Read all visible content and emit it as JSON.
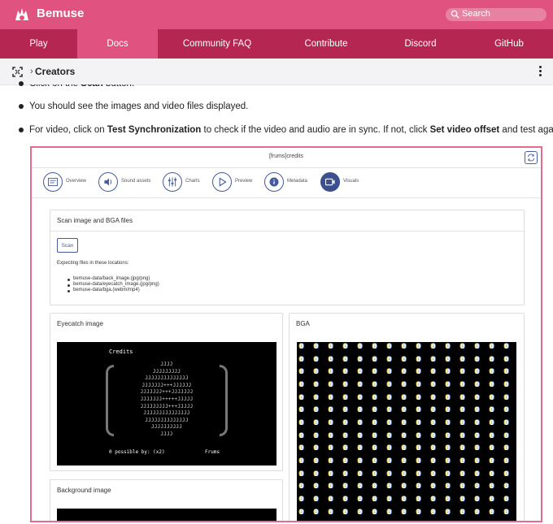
{
  "header": {
    "brand": "Bemuse",
    "search_placeholder": "Search",
    "brand_color": "#e0527f",
    "nav_color": "#b52653"
  },
  "nav": [
    {
      "label": "Play",
      "active": false
    },
    {
      "label": "Docs",
      "active": true
    },
    {
      "label": "Community FAQ",
      "active": false
    },
    {
      "label": "Contribute",
      "active": false
    },
    {
      "label": "Discord",
      "active": false
    },
    {
      "label": "GitHub",
      "active": false
    }
  ],
  "breadcrumb": {
    "current": "Creators"
  },
  "content": {
    "cut_line": {
      "pre": "Click on the ",
      "bold": "Scan",
      "post": " button."
    },
    "line2": "You should see the images and video files displayed.",
    "line3": {
      "pre": "For video, click on ",
      "bold1": "Test Synchronization",
      "mid": " to check if the video and audio are in sync. If not, click ",
      "bold2": "Set video offset",
      "post": " and test again."
    }
  },
  "screenshot": {
    "title": "[frums]credits",
    "tabs": [
      {
        "label": "Overview",
        "icon": "overview-icon",
        "active": false
      },
      {
        "label": "Sound assets",
        "icon": "speaker-icon",
        "active": false
      },
      {
        "label": "Charts",
        "icon": "sliders-icon",
        "active": false
      },
      {
        "label": "Preview",
        "icon": "play-icon",
        "active": false
      },
      {
        "label": "Metadata",
        "icon": "info-icon",
        "active": false
      },
      {
        "label": "Visuals",
        "icon": "video-icon",
        "active": true
      }
    ],
    "scan_panel": {
      "title": "Scan image and BGA files",
      "button": "Scan",
      "expect_label": "Expecting files in these locations:",
      "locations": [
        "bemuse-data/back_image.(jpg/png)",
        "bemuse-data/eyecatch_image.(jpg/png)",
        "bemuse-data/bga.(webm/mp4)"
      ]
    },
    "eyecatch": {
      "title": "Eyecatch image",
      "credits_label": "Credits",
      "art_rows": [
        "JJJJ",
        "JJJJJJJJJ",
        "JJJJJJJJJJJJJJ",
        "JJJJJJJ+++JJJJJJ",
        "JJJJJJJ+++JJJJJJJ",
        "JJJJJJJ+++++JJJJJ",
        "JJJJJJJJJ+++JJJJJ",
        "JJJJJJJJJJJJJJJ",
        "JJJJJJJJJJJJJJ",
        "JJJJJJJJJJ",
        "JJJJ"
      ],
      "footer_left": "0 possible by: (x2)",
      "footer_right": "Frums"
    },
    "bga": {
      "title": "BGA",
      "glyph": "0"
    },
    "background": {
      "title": "Background image"
    }
  }
}
